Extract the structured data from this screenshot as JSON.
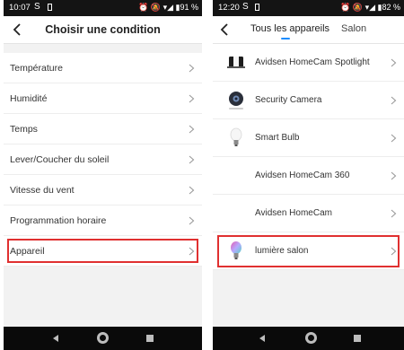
{
  "left_phone": {
    "status": {
      "time": "10:07",
      "right": "⏰ 🔕 ▾◢ ▮91 %"
    },
    "header_title": "Choisir une condition",
    "items": [
      {
        "label": "Température"
      },
      {
        "label": "Humidité"
      },
      {
        "label": "Temps"
      },
      {
        "label": "Lever/Coucher du soleil"
      },
      {
        "label": "Vitesse du vent"
      },
      {
        "label": "Programmation horaire"
      },
      {
        "label": "Appareil",
        "highlighted": true
      }
    ]
  },
  "right_phone": {
    "status": {
      "time": "12:20",
      "right": "⏰ 🔕 ▾◢ ▮82 %"
    },
    "tabs": [
      {
        "label": "Tous les appareils",
        "active": true
      },
      {
        "label": "Salon",
        "active": false
      }
    ],
    "devices": [
      {
        "label": "Avidsen HomeCam Spotlight",
        "icon": "spotlight-camera-icon"
      },
      {
        "label": "Security Camera",
        "icon": "security-camera-icon"
      },
      {
        "label": "Smart Bulb",
        "icon": "light-bulb-icon"
      },
      {
        "label": "Avidsen HomeCam 360",
        "icon": ""
      },
      {
        "label": "Avidsen HomeCam",
        "icon": ""
      },
      {
        "label": "lumière salon",
        "icon": "color-bulb-icon",
        "highlighted": true
      }
    ]
  },
  "colors": {
    "highlight": "#e03030",
    "accent": "#1a8cff",
    "statusbar": "#141414"
  }
}
